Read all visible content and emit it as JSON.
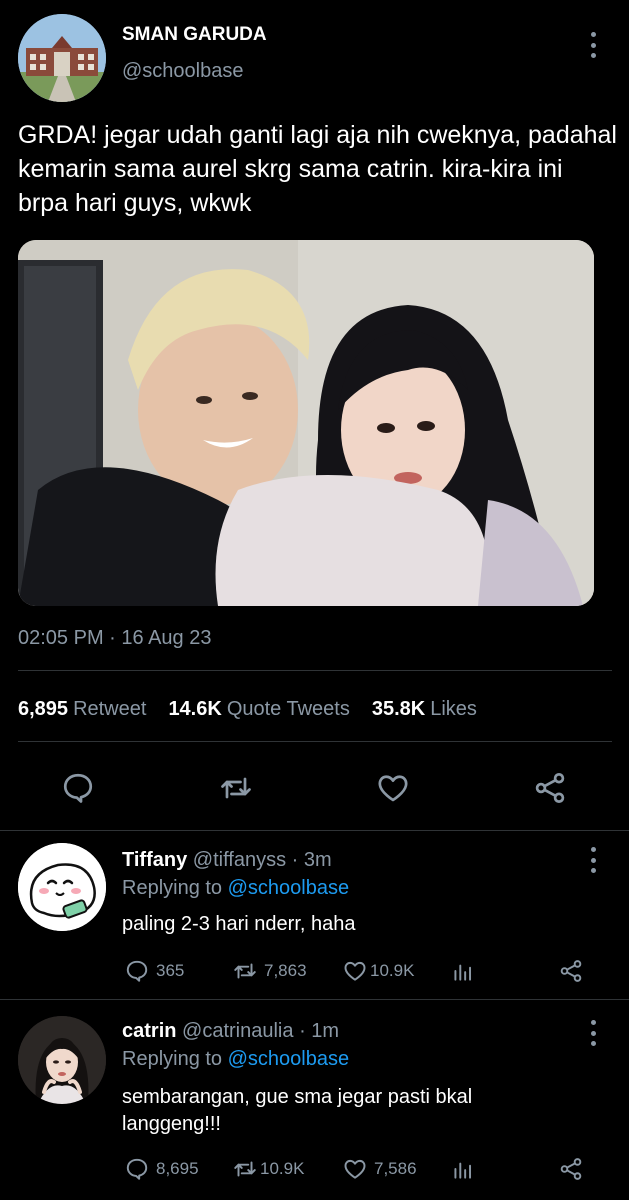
{
  "tweet": {
    "author_name": "SMAN GARUDA",
    "author_handle": "@schoolbase",
    "text": "GRDA! jegar udah ganti lagi aja nih cweknya, padahal kemarin sama aurel skrg sama catrin. kira-kira ini brpa hari guys, wkwk",
    "timestamp": "02:05 PM · 16 Aug 23",
    "stats": {
      "retweet_count": "6,895",
      "retweet_label": "Retweet",
      "quote_count": "14.6K",
      "quote_label": "Quote Tweets",
      "likes_count": "35.8K",
      "likes_label": "Likes"
    }
  },
  "replies": [
    {
      "name": "Tiffany",
      "handle": "@tiffanyss",
      "time": "· 3m",
      "replying_prefix": "Replying to",
      "replying_to": "@schoolbase",
      "text": "paling 2-3 hari nderr, haha",
      "reply_count": "365",
      "retweet_count": "7,863",
      "like_count": "10.9K"
    },
    {
      "name": "catrin",
      "handle": "@catrinaulia",
      "time": "· 1m",
      "replying_prefix": "Replying to",
      "replying_to": "@schoolbase",
      "text": "sembarangan, gue sma jegar pasti bkal langgeng!!!",
      "reply_count": "8,695",
      "retweet_count": "10.9K",
      "like_count": "7,586"
    }
  ],
  "colors": {
    "background": "#000000",
    "secondary_text": "#8b98a5",
    "accent": "#1d9bf0",
    "divider": "#2f3336"
  }
}
